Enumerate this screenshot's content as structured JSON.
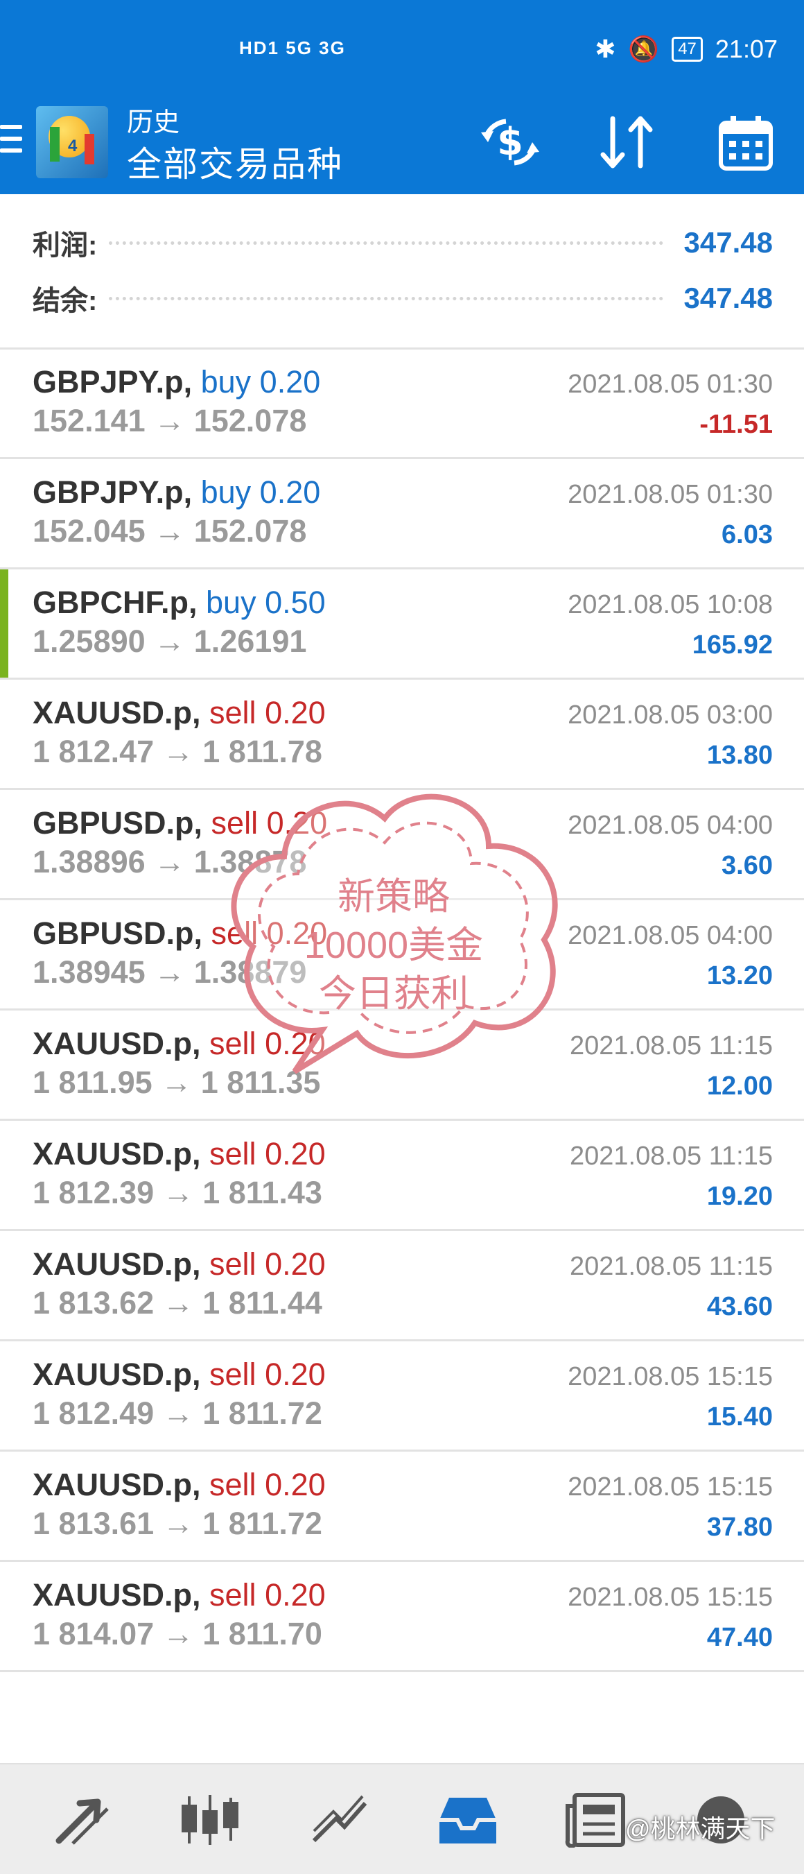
{
  "status_bar": {
    "network": "HD1 5G 3G",
    "battery": "47",
    "time": "21:07"
  },
  "header": {
    "subtitle": "历史",
    "title": "全部交易品种"
  },
  "summary": [
    {
      "label": "利润:",
      "value": "347.48"
    },
    {
      "label": "结余:",
      "value": "347.48"
    }
  ],
  "trades": [
    {
      "symbol": "GBPJPY.p,",
      "side": "buy",
      "lots": "0.20",
      "open": "152.141",
      "close": "152.078",
      "time": "2021.08.05 01:30",
      "profit": "-11.51"
    },
    {
      "symbol": "GBPJPY.p,",
      "side": "buy",
      "lots": "0.20",
      "open": "152.045",
      "close": "152.078",
      "time": "2021.08.05 01:30",
      "profit": "6.03"
    },
    {
      "symbol": "GBPCHF.p,",
      "side": "buy",
      "lots": "0.50",
      "open": "1.25890",
      "close": "1.26191",
      "time": "2021.08.05 10:08",
      "profit": "165.92"
    },
    {
      "symbol": "XAUUSD.p,",
      "side": "sell",
      "lots": "0.20",
      "open": "1 812.47",
      "close": "1 811.78",
      "time": "2021.08.05 03:00",
      "profit": "13.80"
    },
    {
      "symbol": "GBPUSD.p,",
      "side": "sell",
      "lots": "0.20",
      "open": "1.38896",
      "close": "1.38878",
      "time": "2021.08.05 04:00",
      "profit": "3.60"
    },
    {
      "symbol": "GBPUSD.p,",
      "side": "sell",
      "lots": "0.20",
      "open": "1.38945",
      "close": "1.38879",
      "time": "2021.08.05 04:00",
      "profit": "13.20"
    },
    {
      "symbol": "XAUUSD.p,",
      "side": "sell",
      "lots": "0.20",
      "open": "1 811.95",
      "close": "1 811.35",
      "time": "2021.08.05 11:15",
      "profit": "12.00"
    },
    {
      "symbol": "XAUUSD.p,",
      "side": "sell",
      "lots": "0.20",
      "open": "1 812.39",
      "close": "1 811.43",
      "time": "2021.08.05 11:15",
      "profit": "19.20"
    },
    {
      "symbol": "XAUUSD.p,",
      "side": "sell",
      "lots": "0.20",
      "open": "1 813.62",
      "close": "1 811.44",
      "time": "2021.08.05 11:15",
      "profit": "43.60"
    },
    {
      "symbol": "XAUUSD.p,",
      "side": "sell",
      "lots": "0.20",
      "open": "1 812.49",
      "close": "1 811.72",
      "time": "2021.08.05 15:15",
      "profit": "15.40"
    },
    {
      "symbol": "XAUUSD.p,",
      "side": "sell",
      "lots": "0.20",
      "open": "1 813.61",
      "close": "1 811.72",
      "time": "2021.08.05 15:15",
      "profit": "37.80"
    },
    {
      "symbol": "XAUUSD.p,",
      "side": "sell",
      "lots": "0.20",
      "open": "1 814.07",
      "close": "1 811.70",
      "time": "2021.08.05 15:15",
      "profit": "47.40"
    }
  ],
  "stamp": {
    "lines": [
      "新策略",
      "10000美金",
      "今日获利"
    ]
  },
  "watermark": "@桃林满天下",
  "colors": {
    "header_blue": "#0b78d6",
    "profit_blue": "#1a72c9",
    "loss_red": "#c62828",
    "highlight_green": "#7ab31f"
  }
}
